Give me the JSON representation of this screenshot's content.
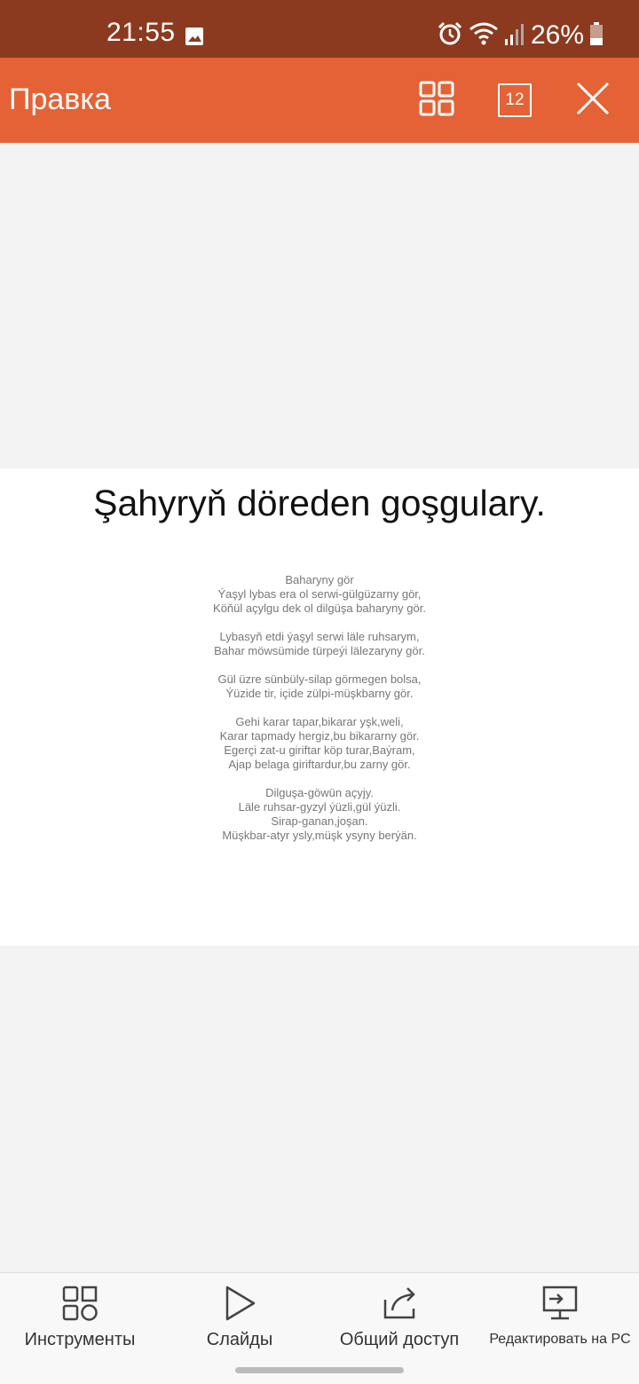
{
  "status_bar": {
    "time": "21:55",
    "battery_percent": "26%",
    "icons": [
      "image-icon",
      "alarm-icon",
      "wifi-icon",
      "signal-icon",
      "battery-icon"
    ]
  },
  "toolbar": {
    "title": "Правка",
    "page_count": "12",
    "icons": [
      "grid-view-icon",
      "page-count-icon",
      "close-icon"
    ]
  },
  "slide": {
    "title": "Şahyryň döreden goşgulary.",
    "stanzas": [
      [
        "Baharyny gör",
        "Ýaşyl lybas era ol serwi-gülgüzarny gör,",
        "Köňül açylgu dek ol dilgüşa baharyny gör."
      ],
      [
        "Lybasyň etdi ýaşyl serwi läle ruhsarym,",
        "Bahar möwsümide türpeýi lälezaryny gör."
      ],
      [
        "Gül üzre sünbüly-silap görmegen bolsa,",
        "Ýüzide tir, içide zülpi-müşkbarny gör."
      ],
      [
        "Gehi karar tapar,bikarar yşk,weli,",
        "Karar tapmady hergiz,bu bikararny gör.",
        "Egerçi zat-u giriftar köp turar,Baýram,",
        "Ajap belaga giriftardur,bu zarny gör."
      ],
      [
        "Dilguşa-göwün açyjy.",
        "Läle ruhsar-gyzyl ýüzli,gül ýüzli.",
        "Sirap-ganan,joşan.",
        "Müşkbar-atyr ysly,müşk ysyny berýän."
      ]
    ]
  },
  "bottom_bar": {
    "items": [
      {
        "label": "Инструменты",
        "icon": "tools-icon"
      },
      {
        "label": "Слайды",
        "icon": "play-icon"
      },
      {
        "label": "Общий доступ",
        "icon": "share-icon"
      },
      {
        "label": "Редактировать на PC",
        "icon": "edit-on-pc-icon"
      }
    ]
  },
  "colors": {
    "status_bar": "#8c3a1f",
    "toolbar": "#e46235",
    "canvas": "#f3f3f3",
    "slide": "#ffffff"
  }
}
